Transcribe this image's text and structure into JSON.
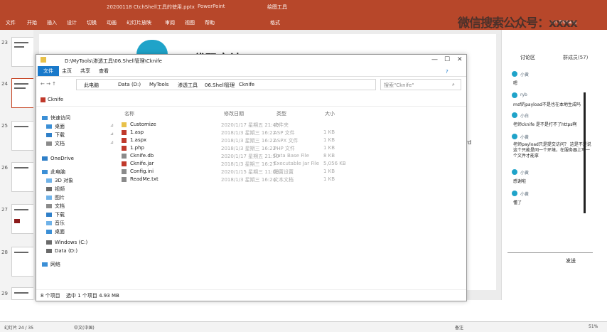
{
  "ppt": {
    "tabs": [
      "文件",
      "开始",
      "插入",
      "设计",
      "切换",
      "动画",
      "幻灯片放映",
      "审阅",
      "视图",
      "帮助",
      "格式"
    ],
    "context_tab": "绘图工具",
    "title": "20200118 CtchShell工具的使用.pptx",
    "app": "PowerPoint",
    "user": "Lin ZhiHang"
  },
  "thumbnails": [
    {
      "num": "23",
      "selected": false
    },
    {
      "num": "24",
      "selected": true
    },
    {
      "num": "25",
      "selected": false
    },
    {
      "num": "26",
      "selected": false
    },
    {
      "num": "27",
      "selected": false
    },
    {
      "num": "28",
      "selected": false
    },
    {
      "num": "29",
      "selected": false
    }
  ],
  "slide": {
    "title": "二、代码审计 1102",
    "side_text": "ord"
  },
  "explorer": {
    "path_title": "D:\\MyTools\\渗透工具\\06.Shell管理\\Cknife",
    "ribbon_tabs": [
      "文件",
      "主页",
      "共享",
      "查看"
    ],
    "breadcrumb": [
      "此电脑",
      "Data (D:)",
      "MyTools",
      "渗透工具",
      "06.Shell管理",
      "Cknife"
    ],
    "search_placeholder": "搜索\"Cknife\"",
    "doc_tab": "Cknife",
    "nav": [
      {
        "label": "快速访问",
        "color": "#3b8fd6"
      },
      {
        "label": "桌面",
        "color": "#3b8fd6"
      },
      {
        "label": "下载",
        "color": "#2f7fc8"
      },
      {
        "label": "文档",
        "color": "#8a8a8a"
      },
      {
        "label": "OneDrive",
        "color": "#2f7fc8"
      },
      {
        "label": "此电脑",
        "color": "#3b8fd6"
      },
      {
        "label": "3D 对象",
        "color": "#6fb2e8"
      },
      {
        "label": "视频",
        "color": "#6a6a6a"
      },
      {
        "label": "图片",
        "color": "#6fb2e8"
      },
      {
        "label": "文档",
        "color": "#8a8a8a"
      },
      {
        "label": "下载",
        "color": "#2f7fc8"
      },
      {
        "label": "音乐",
        "color": "#6fb2e8"
      },
      {
        "label": "桌面",
        "color": "#3b8fd6"
      },
      {
        "label": "Windows (C:)",
        "color": "#6a6a6a"
      },
      {
        "label": "Data (D:)",
        "color": "#6a6a6a"
      },
      {
        "label": "网络",
        "color": "#3b8fd6"
      }
    ],
    "columns": [
      "名称",
      "修改日期",
      "类型",
      "大小"
    ],
    "files": [
      {
        "name": "Customize",
        "date": "2020/1/17 星期五 21:49",
        "type": "文件夹",
        "size": "",
        "icon_color": "#e8c14a"
      },
      {
        "name": "1.asp",
        "date": "2018/1/3 星期三 16:22",
        "type": "ASP 文件",
        "size": "1 KB",
        "icon_color": "#c0392b"
      },
      {
        "name": "1.aspx",
        "date": "2018/1/3 星期三 16:22",
        "type": "ASPX 文件",
        "size": "1 KB",
        "icon_color": "#c0392b"
      },
      {
        "name": "1.php",
        "date": "2018/1/3 星期三 16:22",
        "type": "PHP 文件",
        "size": "1 KB",
        "icon_color": "#c0392b"
      },
      {
        "name": "Cknife.db",
        "date": "2020/1/17 星期五 21:50",
        "type": "Data Base File",
        "size": "8 KB",
        "icon_color": "#8a8a8a"
      },
      {
        "name": "Cknife.jar",
        "date": "2018/1/3 星期三 16:27",
        "type": "Executable Jar File",
        "size": "5,056 KB",
        "icon_color": "#c0392b"
      },
      {
        "name": "Config.ini",
        "date": "2020/1/15 星期三 11:09",
        "type": "配置设置",
        "size": "1 KB",
        "icon_color": "#8a8a8a"
      },
      {
        "name": "ReadMe.txt",
        "date": "2018/1/3 星期三 16:24",
        "type": "文本文档",
        "size": "1 KB",
        "icon_color": "#8a8a8a"
      }
    ],
    "status_count": "8 个项目",
    "status_sel": "选中 1 个项目 4.93 MB"
  },
  "discussion": {
    "tabs": [
      "讨论区",
      "群成员(57)"
    ],
    "messages": [
      {
        "name": "小黄",
        "text": "嗯"
      },
      {
        "name": "ryb",
        "text": "msf的payload不是也在本地生成吗"
      },
      {
        "name": "小白",
        "text": "老师cknife 是不是打不了https啊"
      },
      {
        "name": "小黄",
        "text": "老师payload只是提交访问？ 这是不是说这个只能是同一个环境，在服务器上写一个文件才能拿"
      },
      {
        "name": "小黄",
        "text": "感谢啦"
      },
      {
        "name": "小黄",
        "text": "懂了"
      }
    ],
    "send": "发送"
  },
  "watermark": "微信搜索公众号：xxxx",
  "statusbar": {
    "left": "幻灯片 24 / 35",
    "lang": "中文(中国)",
    "notes": "备注",
    "zoom": "51%"
  }
}
